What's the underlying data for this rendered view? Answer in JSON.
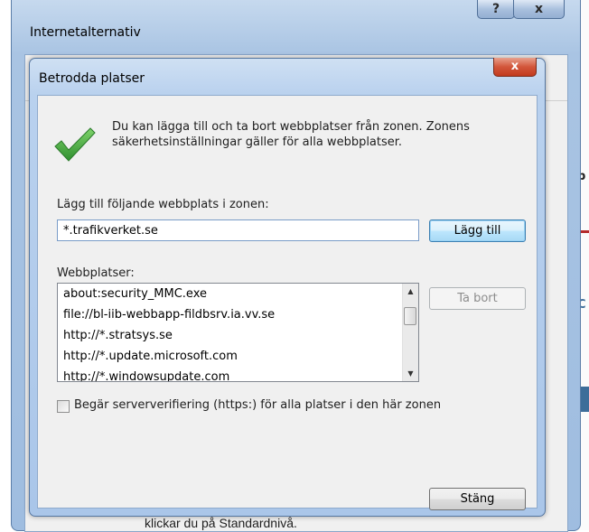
{
  "outer_window": {
    "title": "Internetalternativ",
    "help_label": "?",
    "close_label": "x"
  },
  "background": {
    "bottom_text": "klickar du på Standardnivå."
  },
  "dialog": {
    "title": "Betrodda platser",
    "close_label": "x",
    "info_text": "Du kan lägga till och ta bort webbplatser från zonen. Zonens säkerhetsinställningar gäller för alla webbplatser.",
    "add_label": "Lägg till följande webbplats i zonen:",
    "url_value": "*.trafikverket.se",
    "add_button": "Lägg till",
    "sites_label": "Webbplatser:",
    "sites": [
      "about:security_MMC.exe",
      "file://bl-iib-webbapp-fildbsrv.ia.vv.se",
      "http://*.stratsys.se",
      "http://*.update.microsoft.com",
      "http://*.windowsupdate.com"
    ],
    "remove_button": "Ta bort",
    "https_label": "Begär serververifiering (https:) för alla platser i den här zonen",
    "close_button": "Stäng"
  },
  "colors": {
    "check_green": "#3aa33a",
    "accent_blue": "#3c7fb1",
    "close_red": "#c23a1d"
  }
}
